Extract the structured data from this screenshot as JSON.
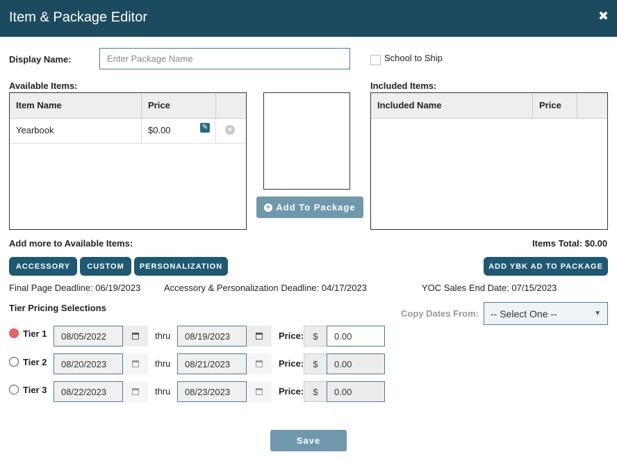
{
  "dialog": {
    "title": "Item & Package Editor",
    "close_glyph": "✖"
  },
  "display_name": {
    "label": "Display Name:",
    "placeholder": "Enter Package Name",
    "value": ""
  },
  "school_to_ship": {
    "label": "School to Ship",
    "checked": false
  },
  "available": {
    "label": "Available Items:",
    "columns": [
      "Item Name",
      "Price",
      ""
    ],
    "rows": [
      {
        "name": "Yearbook",
        "price": "$0.00"
      }
    ]
  },
  "included": {
    "label": "Included Items:",
    "columns": [
      "Included Name",
      "Price",
      ""
    ],
    "rows": []
  },
  "add_to_package": {
    "label": "Add To Package",
    "icon": "plus-circle-icon"
  },
  "add_more": {
    "label": "Add more to Available Items:",
    "buttons": [
      "ACCESSORY",
      "CUSTOM",
      "PERSONALIZATION"
    ]
  },
  "items_total": "Items Total: $0.00",
  "add_ybk_ad": "ADD YBK AD TO PACKAGE",
  "deadlines": {
    "final_page": "Final Page Deadline: 06/19/2023",
    "accessory": "Accessory & Personalization Deadline: 04/17/2023",
    "yoc": "YOC Sales End Date: 07/15/2023"
  },
  "tier_pricing": {
    "label": "Tier Pricing Selections",
    "copy_dates_label": "Copy Dates From:",
    "copy_dates_selected": "-- Select One --",
    "thru": "thru",
    "price_label": "Price:",
    "currency": "$",
    "tiers": [
      {
        "name": "Tier 1",
        "selected": true,
        "start": "08/05/2022",
        "end": "08/19/2023",
        "price": "0.00"
      },
      {
        "name": "Tier 2",
        "selected": false,
        "start": "08/20/2023",
        "end": "08/21/2023",
        "price": "0.00"
      },
      {
        "name": "Tier 3",
        "selected": false,
        "start": "08/22/2023",
        "end": "08/23/2023",
        "price": "0.00"
      }
    ]
  },
  "save_label": "Save",
  "colors": {
    "header": "#1c4a5e",
    "pill": "#1f5872",
    "muted_button": "#6f98ad",
    "radio_selected": "#e46464"
  }
}
